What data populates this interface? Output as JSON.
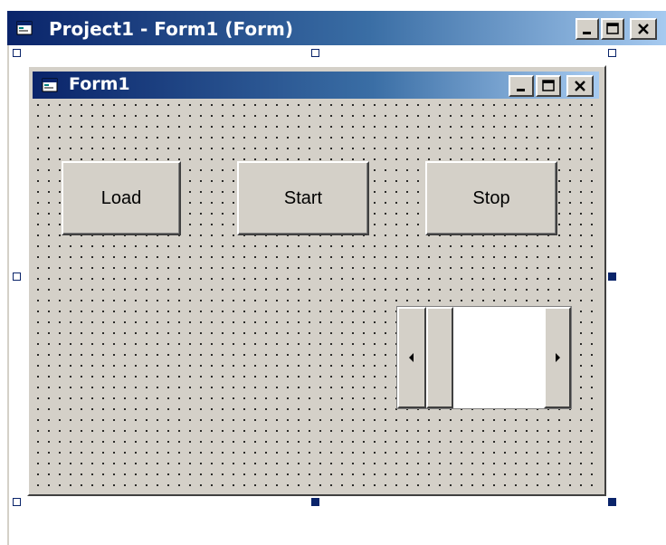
{
  "designer_window": {
    "title": "Project1 - Form1 (Form)",
    "icon": "form-icon",
    "controls": [
      "minimize-icon",
      "maximize-icon",
      "close-icon"
    ]
  },
  "form": {
    "title": "Form1",
    "icon": "form-icon",
    "controls": [
      "minimize-icon",
      "maximize-icon",
      "close-icon"
    ]
  },
  "buttons": {
    "load_label": "Load",
    "start_label": "Start",
    "stop_label": "Stop"
  },
  "scrollbar": {
    "orientation": "horizontal",
    "left_arrow": "left-arrow-icon",
    "right_arrow": "right-arrow-icon",
    "position": 0
  },
  "colors": {
    "title_active": "#0a246a",
    "title_gradient_end": "#a6caf0",
    "face": "#d4d0c8",
    "handle": "#0a246a"
  }
}
